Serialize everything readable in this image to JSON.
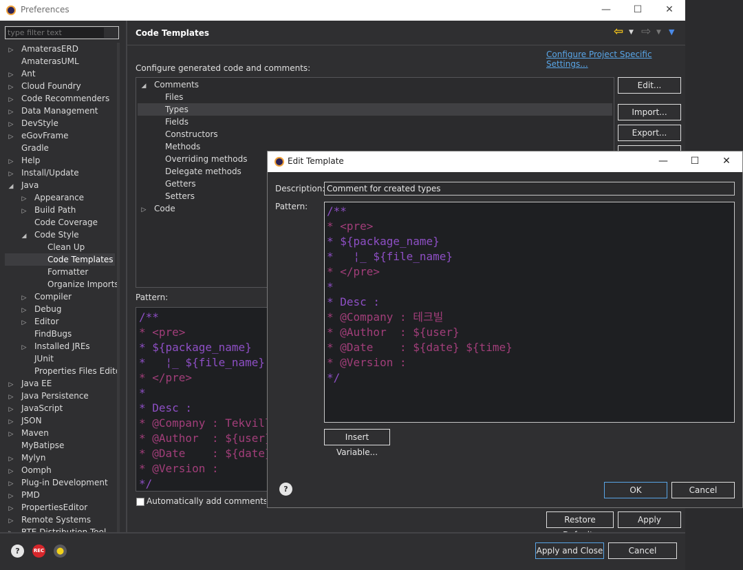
{
  "prefs": {
    "title": "Preferences",
    "filter_placeholder": "type filter text",
    "tree": [
      {
        "label": "AmaterasERD",
        "arrow": "▷"
      },
      {
        "label": "AmaterasUML",
        "arrow": ""
      },
      {
        "label": "Ant",
        "arrow": "▷"
      },
      {
        "label": "Cloud Foundry",
        "arrow": "▷"
      },
      {
        "label": "Code Recommenders",
        "arrow": "▷"
      },
      {
        "label": "Data Management",
        "arrow": "▷"
      },
      {
        "label": "DevStyle",
        "arrow": "▷"
      },
      {
        "label": "eGovFrame",
        "arrow": "▷"
      },
      {
        "label": "Gradle",
        "arrow": ""
      },
      {
        "label": "Help",
        "arrow": "▷"
      },
      {
        "label": "Install/Update",
        "arrow": "▷"
      },
      {
        "label": "Java",
        "arrow": "◢"
      },
      {
        "label": "Appearance",
        "arrow": "▷"
      },
      {
        "label": "Build Path",
        "arrow": "▷"
      },
      {
        "label": "Code Coverage",
        "arrow": ""
      },
      {
        "label": "Code Style",
        "arrow": "◢"
      },
      {
        "label": "Clean Up",
        "arrow": ""
      },
      {
        "label": "Code Templates",
        "arrow": ""
      },
      {
        "label": "Formatter",
        "arrow": ""
      },
      {
        "label": "Organize Imports",
        "arrow": ""
      },
      {
        "label": "Compiler",
        "arrow": "▷"
      },
      {
        "label": "Debug",
        "arrow": "▷"
      },
      {
        "label": "Editor",
        "arrow": "▷"
      },
      {
        "label": "FindBugs",
        "arrow": ""
      },
      {
        "label": "Installed JREs",
        "arrow": "▷"
      },
      {
        "label": "JUnit",
        "arrow": ""
      },
      {
        "label": "Properties Files Editor",
        "arrow": ""
      },
      {
        "label": "Java EE",
        "arrow": "▷"
      },
      {
        "label": "Java Persistence",
        "arrow": "▷"
      },
      {
        "label": "JavaScript",
        "arrow": "▷"
      },
      {
        "label": "JSON",
        "arrow": "▷"
      },
      {
        "label": "Maven",
        "arrow": "▷"
      },
      {
        "label": "MyBatipse",
        "arrow": ""
      },
      {
        "label": "Mylyn",
        "arrow": "▷"
      },
      {
        "label": "Oomph",
        "arrow": "▷"
      },
      {
        "label": "Plug-in Development",
        "arrow": "▷"
      },
      {
        "label": "PMD",
        "arrow": "▷"
      },
      {
        "label": "PropertiesEditor",
        "arrow": "▷"
      },
      {
        "label": "Remote Systems",
        "arrow": "▷"
      },
      {
        "label": "RTE Distribution Tool",
        "arrow": "▷"
      }
    ],
    "page_title": "Code Templates",
    "config_link": "Configure Project Specific Settings...",
    "config_label": "Configure generated code and comments:",
    "templates": [
      {
        "label": "Comments",
        "arrow": "◢"
      },
      {
        "label": "Files",
        "arrow": ""
      },
      {
        "label": "Types",
        "arrow": ""
      },
      {
        "label": "Fields",
        "arrow": ""
      },
      {
        "label": "Constructors",
        "arrow": ""
      },
      {
        "label": "Methods",
        "arrow": ""
      },
      {
        "label": "Overriding methods",
        "arrow": ""
      },
      {
        "label": "Delegate methods",
        "arrow": ""
      },
      {
        "label": "Getters",
        "arrow": ""
      },
      {
        "label": "Setters",
        "arrow": ""
      },
      {
        "label": "Code",
        "arrow": "▷"
      }
    ],
    "edit_btn": "Edit...",
    "import_btn": "Import...",
    "export_btn": "Export...",
    "pattern_label": "Pattern:",
    "pattern_lines": [
      "/**",
      "* <pre>",
      "* ${package_name}",
      "*   ¦_ ${file_name}",
      "* </pre>",
      "*",
      "* Desc :",
      "* @Company : Tekville",
      "* @Author  : ${user}",
      "* @Date    : ${date}",
      "* @Version :",
      "*/"
    ],
    "auto_comments_label": "Automatically add comments fo",
    "restore_btn": "Restore Defaults",
    "apply_btn": "Apply",
    "apply_close_btn": "Apply and Close",
    "cancel_btn": "Cancel",
    "rec_label": "REC"
  },
  "dialog": {
    "title": "Edit Template",
    "description_label": "Description:",
    "description_value": "Comment for created types",
    "pattern_label": "Pattern:",
    "pattern_lines": [
      "/**",
      "* <pre>",
      "* ${package_name}",
      "*   ¦_ ${file_name}",
      "* </pre>",
      "*",
      "* Desc :",
      "* @Company : 테크빌",
      "* @Author  : ${user}",
      "* @Date    : ${date} ${time}",
      "* @Version :",
      "*/"
    ],
    "insert_variable_btn": "Insert Variable...",
    "ok_btn": "OK",
    "cancel_btn": "Cancel"
  },
  "colors": {
    "code_purple": "#8e4fc5",
    "code_pink": "#a23e7a",
    "accent_blue": "#59a6e8",
    "nav_yellow": "#f2c21b"
  }
}
